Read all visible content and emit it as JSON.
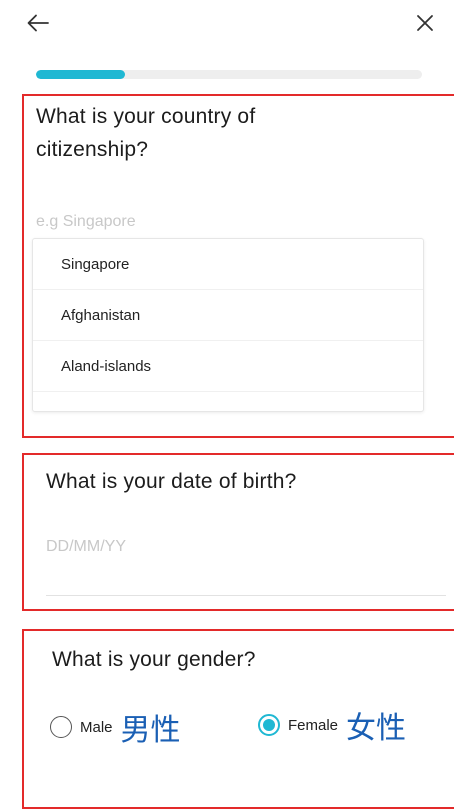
{
  "nav": {
    "back_icon": "arrow-left-icon",
    "close_icon": "close-icon"
  },
  "progress": {
    "fraction": 0.23,
    "color": "#1fb8d3"
  },
  "citizenship": {
    "question_line1": "What is your country of",
    "question_line2": "citizenship?",
    "placeholder": "e.g Singapore",
    "options": [
      "Singapore",
      "Afghanistan",
      "Aland-islands"
    ]
  },
  "birth": {
    "question": "What is your date of birth?",
    "placeholder": "DD/MM/YY"
  },
  "gender": {
    "question": "What is your gender?",
    "male_label": "Male",
    "male_cjk": "男性",
    "female_label": "Female",
    "female_cjk": "女性",
    "selected": "female"
  },
  "colors": {
    "accent": "#1fb8d3",
    "annotation_red": "#e32a2a",
    "cjk_blue": "#1a5fb4"
  }
}
